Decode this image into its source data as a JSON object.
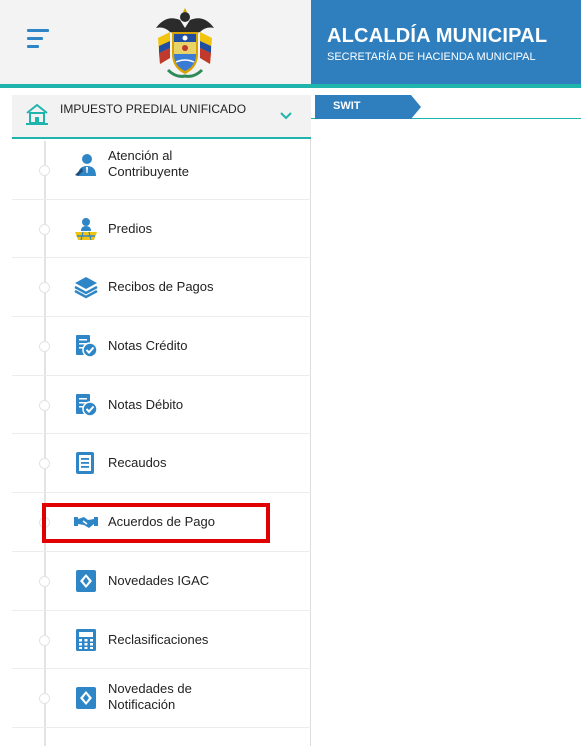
{
  "header": {
    "title": "ALCALDÍA MUNICIPAL",
    "subtitle": "SECRETARÍA DE HACIENDA MUNICIPAL"
  },
  "breadcrumb": {
    "label": "SWIT"
  },
  "colors": {
    "brand_blue": "#2f7fbf",
    "accent_teal": "#1fb5ad",
    "highlight_red": "#e00000",
    "icon_blue": "#2f86c6"
  },
  "sidebar": {
    "section": {
      "label": "IMPUESTO PREDIAL UNIFICADO",
      "icon": "house-icon"
    },
    "items": [
      {
        "label": "Atención al Contribuyente",
        "icon": "person-support-icon"
      },
      {
        "label": "Predios",
        "icon": "land-parcel-icon"
      },
      {
        "label": "Recibos de Pagos",
        "icon": "stack-layers-icon"
      },
      {
        "label": "Notas Crédito",
        "icon": "document-check-icon"
      },
      {
        "label": "Notas Débito",
        "icon": "document-check-icon"
      },
      {
        "label": "Recaudos",
        "icon": "receipt-icon"
      },
      {
        "label": "Acuerdos de Pago",
        "icon": "handshake-icon"
      },
      {
        "label": "Novedades IGAC",
        "icon": "diamond-badge-icon"
      },
      {
        "label": "Reclasificaciones",
        "icon": "calculator-icon"
      },
      {
        "label": "Novedades de Notificación",
        "icon": "diamond-badge-icon"
      }
    ]
  }
}
